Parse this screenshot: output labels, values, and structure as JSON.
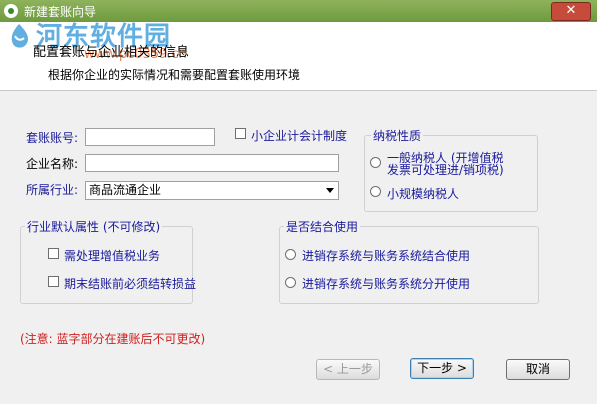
{
  "window": {
    "title": "新建套账向导",
    "close_label": "✕"
  },
  "watermark": {
    "text": "河东软件园",
    "url": "www.pc0359.cn"
  },
  "header": {
    "title": "配置套账与企业相关的信息",
    "subtitle": "根据你企业的实际情况和需要配置套账使用环境"
  },
  "form": {
    "account_no_label": "套账账号:",
    "account_no_value": "",
    "small_business_label": "小企业计会计制度",
    "company_name_label": "企业名称:",
    "company_name_value": "",
    "industry_label": "所属行业:",
    "industry_value": "商品流通企业"
  },
  "taxpayer": {
    "title": "纳税性质",
    "general_line1": "一般纳税人 (开增值税",
    "general_line2": "发票可处理进/销项税)",
    "small": "小规模纳税人"
  },
  "industry_default": {
    "title": "行业默认属性 (不可修改)",
    "vat": "需处理增值税业务",
    "period_end": "期末结账前必须结转损益"
  },
  "combine": {
    "title": "是否结合使用",
    "combined": "进销存系统与账务系统结合使用",
    "separate": "进销存系统与账务系统分开使用"
  },
  "note": "(注意: 蓝字部分在建账后不可更改)",
  "buttons": {
    "prev": "< 上一步",
    "next": "下一步 >",
    "cancel": "取消"
  }
}
